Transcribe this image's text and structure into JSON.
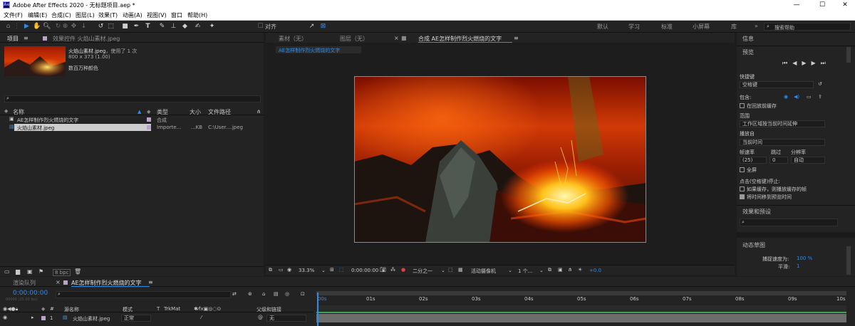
{
  "window": {
    "app_title": "Adobe After Effects 2020 - 无标题项目.aep *",
    "logo": "Ae",
    "minimize": "—",
    "maximize": "☐",
    "close": "✕"
  },
  "menu": [
    "文件(F)",
    "编辑(E)",
    "合成(C)",
    "图层(L)",
    "效果(T)",
    "动画(A)",
    "视图(V)",
    "窗口",
    "帮助(H)"
  ],
  "toolbar": {
    "snap_label": "对齐",
    "workspaces": [
      "默认",
      "学习",
      "标准",
      "小屏幕",
      "库"
    ],
    "more": "»",
    "search_placeholder": "搜索帮助"
  },
  "project_panel": {
    "tab": "项目",
    "effects_tab": "效果控件 火焰山素材.jpeg",
    "asset_name": "火焰山素材.jpeg",
    "asset_usage": "，使用了 1 次",
    "asset_dims": "800 x 373 (1.00)",
    "asset_colors": "数百万种颜色",
    "columns": {
      "name": "名称",
      "type": "类型",
      "size": "大小",
      "path": "文件路径"
    },
    "rows": [
      {
        "name": "AE怎样制作烈火燃烧的文字",
        "type": "合成",
        "size": "",
        "path": "",
        "color": "#b9a3c8",
        "selected": false
      },
      {
        "name": "火焰山素材.jpeg",
        "type": "Importe...",
        "size": "...KB",
        "path": "C:\\User....jpeg",
        "color": "#b9a3c8",
        "selected": true
      }
    ],
    "bpc": "8 bpc"
  },
  "comp_viewer": {
    "tabs": [
      {
        "label": "素材（无）"
      },
      {
        "label": "图层（无）"
      },
      {
        "label": "合成 AE怎样制作烈火燃烧的文字"
      }
    ],
    "breadcrumb": "AE怎样制作烈火燃烧的文字",
    "zoom": "33.3%",
    "timecode": "0:00:00:00",
    "resolution": "二分之一",
    "camera": "活动摄像机",
    "views": "1 个...",
    "exposure": "+0.0"
  },
  "info_panel": {
    "title": "信息",
    "preview_title": "预览",
    "shortcut_label": "快捷键",
    "shortcut_value": "空格键",
    "include_label": "包含:",
    "cache_before": "在回放前缓存",
    "range_label": "范围",
    "range_value": "工作区域按当前时间延伸",
    "play_from_label": "播放自",
    "play_from_value": "当前时间",
    "fps_label": "帧速率",
    "skip_label": "跳过",
    "res_label": "分辨率",
    "fps_value": "(25)",
    "skip_value": "0",
    "res_value": "自动",
    "fullscreen": "全屏",
    "stop_label": "点击(空格键)停止:",
    "stop_opt1": "如果缓存，则播放缓存的帧",
    "stop_opt2": "将时间移到预览时间",
    "effects_title": "效果和预设",
    "brush_title": "动态草图",
    "capture_label": "捕捉速度为:",
    "capture_value": "100 %",
    "smooth_label": "平滑:",
    "smooth_value": "1"
  },
  "timeline": {
    "render_tab": "渲染队列",
    "comp_tab": "AE怎样制作烈火燃烧的文字",
    "timecode": "0:00:00:00",
    "fps_note": "00000 (25.00 fps)",
    "columns": {
      "num": "#",
      "name": "源名称",
      "mode": "模式",
      "t": "T",
      "trkmat": "TrkMat",
      "parent": "父级和链接"
    },
    "layer": {
      "index": "1",
      "name": "火焰山素材.jpeg",
      "mode": "正常",
      "parent": "无"
    },
    "ruler": [
      "00s",
      "01s",
      "02s",
      "03s",
      "04s",
      "05s",
      "06s",
      "07s",
      "08s",
      "09s",
      "10s"
    ]
  },
  "colors": {
    "accent": "#2d8ceb",
    "panel": "#232323",
    "bg": "#1d1d1d",
    "label_purple": "#b9a3c8"
  },
  "icons": [
    "selection-icon",
    "hand-icon",
    "zoom-icon",
    "rotate-icon",
    "camera-orbit-icon",
    "pan-icon",
    "rectangle-icon",
    "pen-icon",
    "text-icon",
    "brush-icon",
    "clone-icon",
    "eraser-icon",
    "roto-icon",
    "puppet-icon",
    "search-icon",
    "folder-icon",
    "camera-icon"
  ]
}
